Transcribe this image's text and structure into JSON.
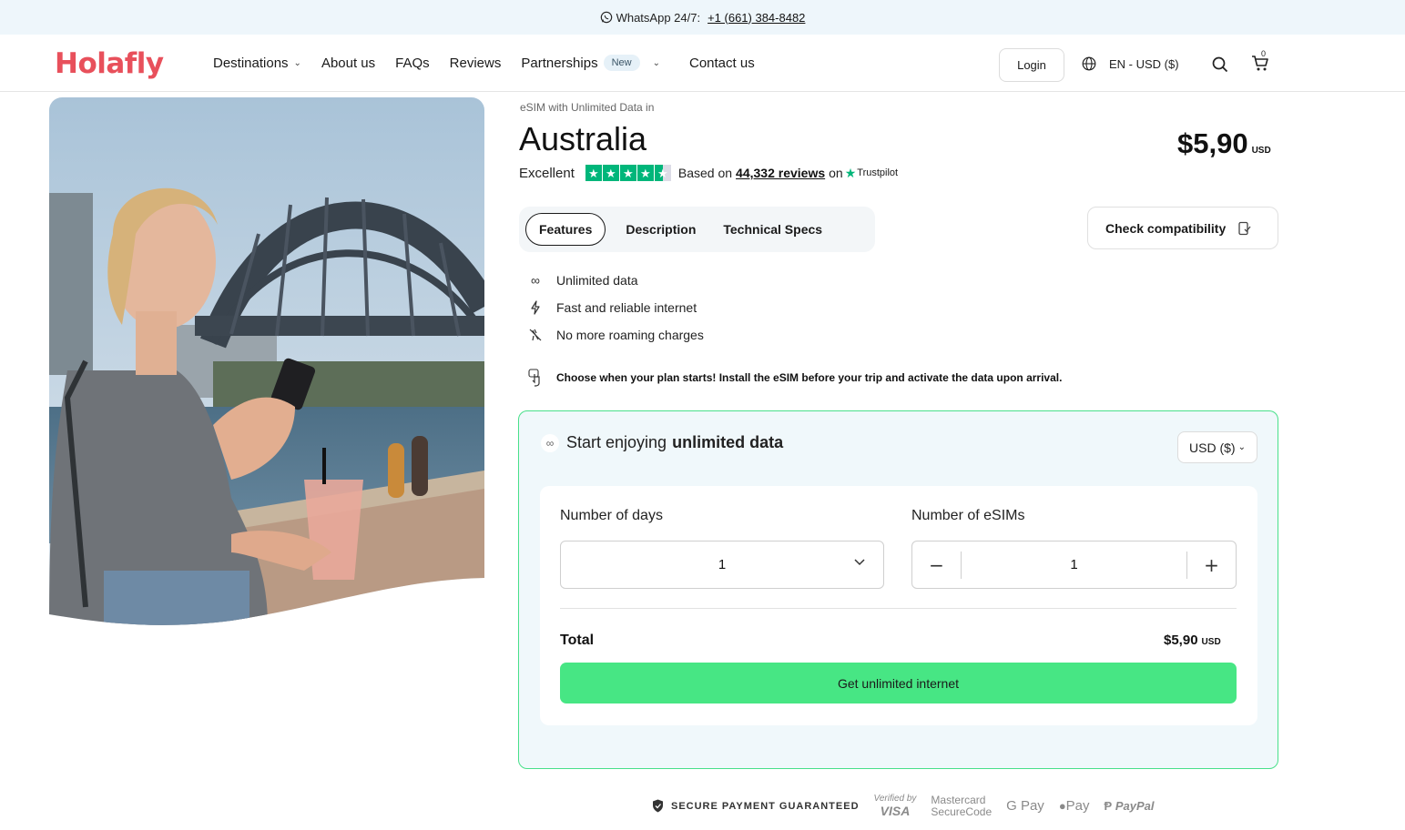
{
  "topbar": {
    "whatsapp_label": "WhatsApp 24/7:",
    "whatsapp_number": "+1 (661) 384-8482"
  },
  "header": {
    "logo": "Holafly",
    "nav": [
      {
        "label": "Destinations"
      },
      {
        "label": "About us"
      },
      {
        "label": "FAQs"
      },
      {
        "label": "Reviews"
      },
      {
        "label": "Partnerships",
        "badge": "New"
      },
      {
        "label": "Contact us"
      }
    ],
    "login": "Login",
    "language": "EN - USD ($)",
    "cart_count": "0"
  },
  "product": {
    "eyebrow": "eSIM with Unlimited Data in",
    "country": "Australia",
    "price": "$5,90",
    "price_currency": "USD",
    "rating_label": "Excellent",
    "rating_stars": 4.5,
    "based_on": "Based on",
    "reviews_count": "44,332 reviews",
    "on": "on",
    "trustpilot": "Trustpilot"
  },
  "tabs": [
    "Features",
    "Description",
    "Technical Specs"
  ],
  "compatibility": "Check compatibility",
  "features": [
    {
      "icon": "infinity-icon",
      "label": "Unlimited data"
    },
    {
      "icon": "lightning-icon",
      "label": "Fast and reliable internet"
    },
    {
      "icon": "no-roaming-icon",
      "label": "No more roaming charges"
    }
  ],
  "notice": "Choose when your plan starts! Install the eSIM before your trip and activate the data upon arrival.",
  "plan": {
    "title_prefix": "Start enjoying",
    "title_bold": "unlimited data",
    "currency": "USD ($)",
    "days_label": "Number of days",
    "days_value": "1",
    "esims_label": "Number of eSIMs",
    "esims_value": "1",
    "total_label": "Total",
    "total_price": "$5,90",
    "total_currency": "USD",
    "cta": "Get unlimited internet"
  },
  "payments": {
    "secure": "SECURE PAYMENT GUARANTEED",
    "visa_top": "Verified by",
    "visa_bottom": "VISA",
    "mc_top": "Mastercard",
    "mc_bottom": "SecureCode",
    "gpay": "G Pay",
    "apay": "Pay",
    "paypal": "PayPal"
  },
  "colors": {
    "brand": "#e8505b",
    "cta": "#47e684",
    "plan_border": "#49e08a",
    "trustpilot": "#00b67a"
  }
}
